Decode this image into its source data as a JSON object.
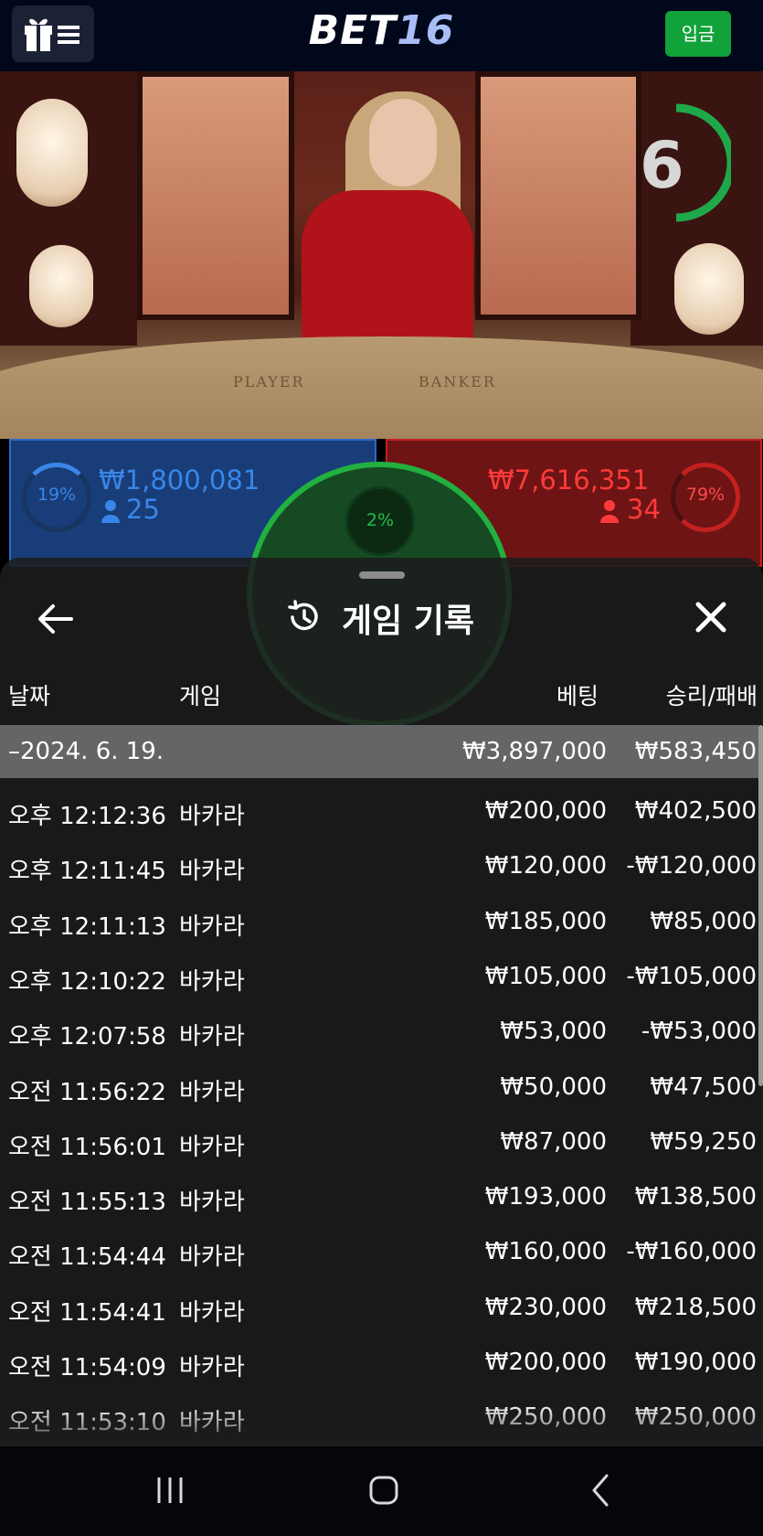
{
  "header": {
    "logo_main": "BET",
    "logo_num": "16",
    "deposit_label": "입금"
  },
  "video": {
    "countdown": "6",
    "table_labels": [
      "PLAYER",
      "BANKER"
    ]
  },
  "bets": {
    "player": {
      "percent": "19%",
      "amount": "₩1,800,081",
      "players": "25"
    },
    "banker": {
      "percent": "79%",
      "amount": "₩7,616,351",
      "players": "34"
    },
    "tie": {
      "percent": "2%"
    }
  },
  "history": {
    "title": "게임 기록",
    "columns": {
      "date": "날짜",
      "game": "게임",
      "bet": "베팅",
      "result": "승리/패배"
    },
    "date_group": {
      "date": "–2024. 6. 19.",
      "bet": "₩3,897,000",
      "result": "₩583,450"
    },
    "rows": [
      {
        "time": "오후 12:12:36",
        "game": "바카라",
        "bet": "₩200,000",
        "result": "₩402,500"
      },
      {
        "time": "오후 12:11:45",
        "game": "바카라",
        "bet": "₩120,000",
        "result": "-₩120,000"
      },
      {
        "time": "오후 12:11:13",
        "game": "바카라",
        "bet": "₩185,000",
        "result": "₩85,000"
      },
      {
        "time": "오후 12:10:22",
        "game": "바카라",
        "bet": "₩105,000",
        "result": "-₩105,000"
      },
      {
        "time": "오후 12:07:58",
        "game": "바카라",
        "bet": "₩53,000",
        "result": "-₩53,000"
      },
      {
        "time": "오전 11:56:22",
        "game": "바카라",
        "bet": "₩50,000",
        "result": "₩47,500"
      },
      {
        "time": "오전 11:56:01",
        "game": "바카라",
        "bet": "₩87,000",
        "result": "₩59,250"
      },
      {
        "time": "오전 11:55:13",
        "game": "바카라",
        "bet": "₩193,000",
        "result": "₩138,500"
      },
      {
        "time": "오전 11:54:44",
        "game": "바카라",
        "bet": "₩160,000",
        "result": "-₩160,000"
      },
      {
        "time": "오전 11:54:41",
        "game": "바카라",
        "bet": "₩230,000",
        "result": "₩218,500"
      },
      {
        "time": "오전 11:54:09",
        "game": "바카라",
        "bet": "₩200,000",
        "result": "₩190,000"
      },
      {
        "time": "오전 11:53:10",
        "game": "바카라",
        "bet": "₩250,000",
        "result": "₩250,000"
      }
    ]
  },
  "icons": {
    "menu": "gift-menu-icon",
    "back": "arrow-left-icon",
    "history": "history-icon",
    "close": "close-icon",
    "nav": [
      "recent-apps-icon",
      "home-icon",
      "back-nav-icon"
    ]
  },
  "colors": {
    "player": "#2f68c8",
    "banker": "#c42020",
    "tie": "#22b040",
    "deposit": "#11a23a"
  }
}
